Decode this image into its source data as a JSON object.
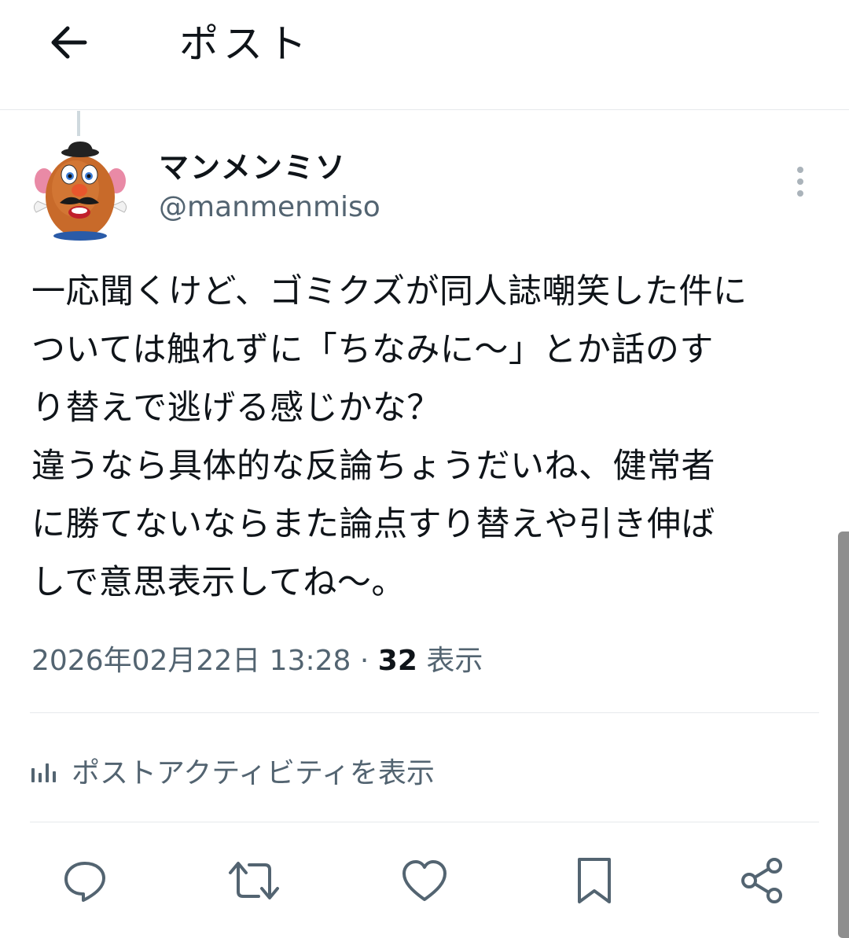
{
  "header": {
    "title": "ポスト"
  },
  "author": {
    "display_name": "マンメンミソ",
    "handle": "@manmenmiso"
  },
  "post": {
    "lines": [
      "一応聞くけど、ゴミクズが同人誌嘲笑した件に",
      "ついては触れずに「ちなみに〜」とか話のす",
      "り替えで逃げる感じかな？",
      "違うなら具体的な反論ちょうだいね、健常者",
      "に勝てないならまた論点すり替えや引き伸ば",
      "しで意思表示してね〜。"
    ]
  },
  "meta": {
    "timestamp": "2026年02月22日 13:28",
    "separator": "·",
    "views_count": "32",
    "views_label": "表示"
  },
  "activity": {
    "label": "ポストアクティビティを表示"
  },
  "actions": {
    "reply": "reply-icon",
    "repost": "repost-icon",
    "like": "heart-icon",
    "bookmark": "bookmark-icon",
    "share": "share-icon"
  },
  "colors": {
    "text": "#0f1419",
    "secondary": "#536471",
    "divider": "#e6e9ec"
  }
}
